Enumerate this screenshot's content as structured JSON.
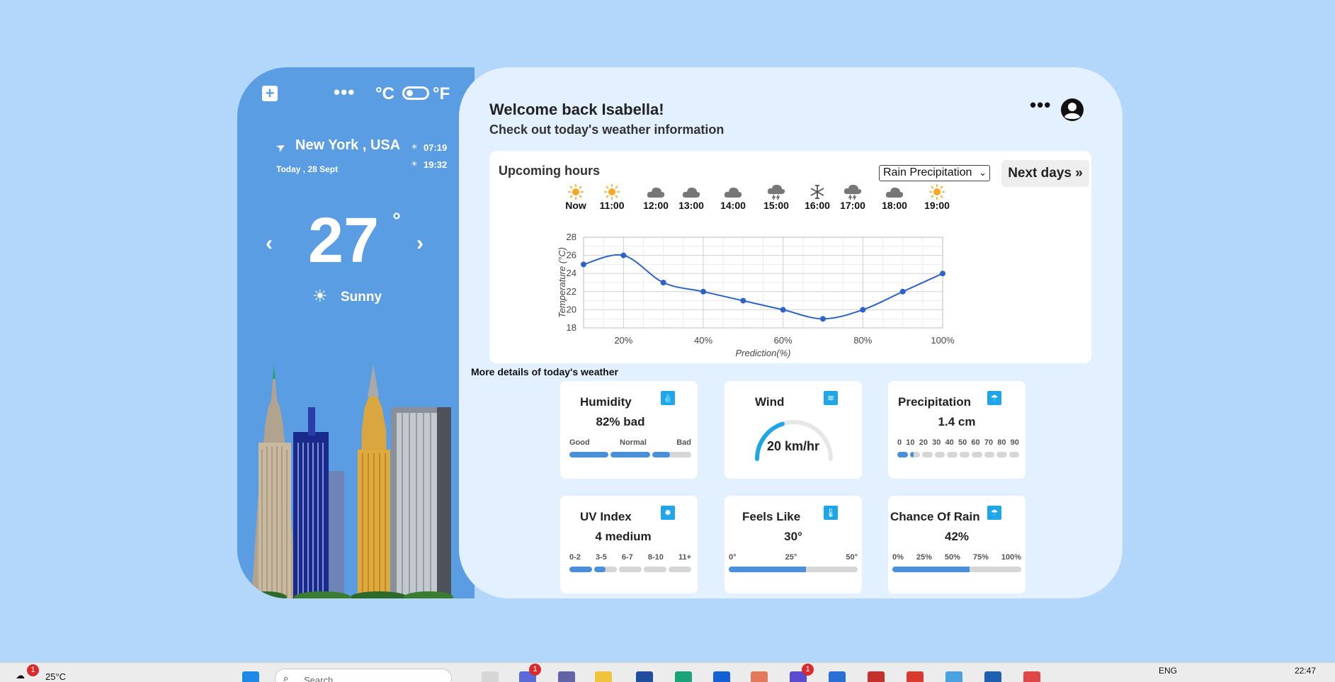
{
  "left_panel": {
    "add_label": "+",
    "menu_label": "•••",
    "unit_celsius": "°C",
    "unit_fahrenheit": "°F",
    "location": "New York , USA",
    "date": "Today , 28 Sept",
    "sunrise": "07:19",
    "sunset": "19:32",
    "prev": "‹",
    "next": "›",
    "temperature": "27",
    "degree": "°",
    "condition": "Sunny"
  },
  "header": {
    "welcome": "Welcome back Isabella!",
    "subtitle": "Check out today's weather information",
    "menu_label": "•••"
  },
  "hours_panel": {
    "title": "Upcoming hours",
    "select_value": "Rain Precipitation",
    "next_days": "Next days »",
    "hours": [
      {
        "label": "Now",
        "icon": "sun-icon"
      },
      {
        "label": "11:00",
        "icon": "sun-icon"
      },
      {
        "label": "12:00",
        "icon": "cloud-icon"
      },
      {
        "label": "13:00",
        "icon": "cloud-icon"
      },
      {
        "label": "14:00",
        "icon": "cloud-icon"
      },
      {
        "label": "15:00",
        "icon": "storm-icon"
      },
      {
        "label": "16:00",
        "icon": "snow-icon"
      },
      {
        "label": "17:00",
        "icon": "storm-icon"
      },
      {
        "label": "18:00",
        "icon": "cloud-icon"
      },
      {
        "label": "19:00",
        "icon": "sun-icon"
      }
    ]
  },
  "chart_data": {
    "type": "line",
    "x": [
      10,
      20,
      30,
      40,
      50,
      60,
      70,
      80,
      90,
      100
    ],
    "y": [
      25,
      26,
      23,
      22,
      21,
      20,
      19,
      20,
      22,
      24
    ],
    "xlabel": "Prediction(%)",
    "ylabel": "Temperature (°C)",
    "x_ticks": [
      "20%",
      "40%",
      "60%",
      "80%",
      "100%"
    ],
    "y_ticks": [
      "18",
      "20",
      "22",
      "24",
      "26",
      "28"
    ],
    "xlim": [
      10,
      100
    ],
    "ylim": [
      18,
      28
    ],
    "grid": true,
    "color": "#2d63c8"
  },
  "details": {
    "title": "More details of today's weather",
    "humidity": {
      "title": "Humidity",
      "value": "82% bad",
      "scale": [
        "Good",
        "Normal",
        "Bad"
      ],
      "level": 0.82
    },
    "wind": {
      "title": "Wind",
      "value": "20 km/hr",
      "level": 0.4
    },
    "precipitation": {
      "title": "Precipitation",
      "value": "1.4 cm",
      "scale": [
        "0",
        "10",
        "20",
        "30",
        "40",
        "50",
        "60",
        "70",
        "80",
        "90"
      ],
      "level": 0.14
    },
    "uv": {
      "title": "UV Index",
      "value": "4 medium",
      "scale": [
        "0-2",
        "3-5",
        "6-7",
        "8-10",
        "11+"
      ],
      "level": 0.3
    },
    "feels_like": {
      "title": "Feels Like",
      "value": "30°",
      "scale": [
        "0°",
        "25°",
        "50°"
      ],
      "level": 0.6
    },
    "chance_rain": {
      "title": "Chance Of Rain",
      "value": "42%",
      "scale": [
        "0%",
        "25%",
        "50%",
        "75%",
        "100%"
      ],
      "level": 0.6
    }
  },
  "taskbar": {
    "weather_temp": "25°C",
    "weather_badge": "1",
    "search_placeholder": "Search",
    "lang": "ENG",
    "time": "22:47",
    "badge_a": "1",
    "badge_b": "1"
  },
  "colors": {
    "accent": "#5b9de2",
    "background": "#b3d6fb",
    "panel": "#e2f0ff",
    "bar": "#4a90d9",
    "icon": "#1fa6e8"
  }
}
